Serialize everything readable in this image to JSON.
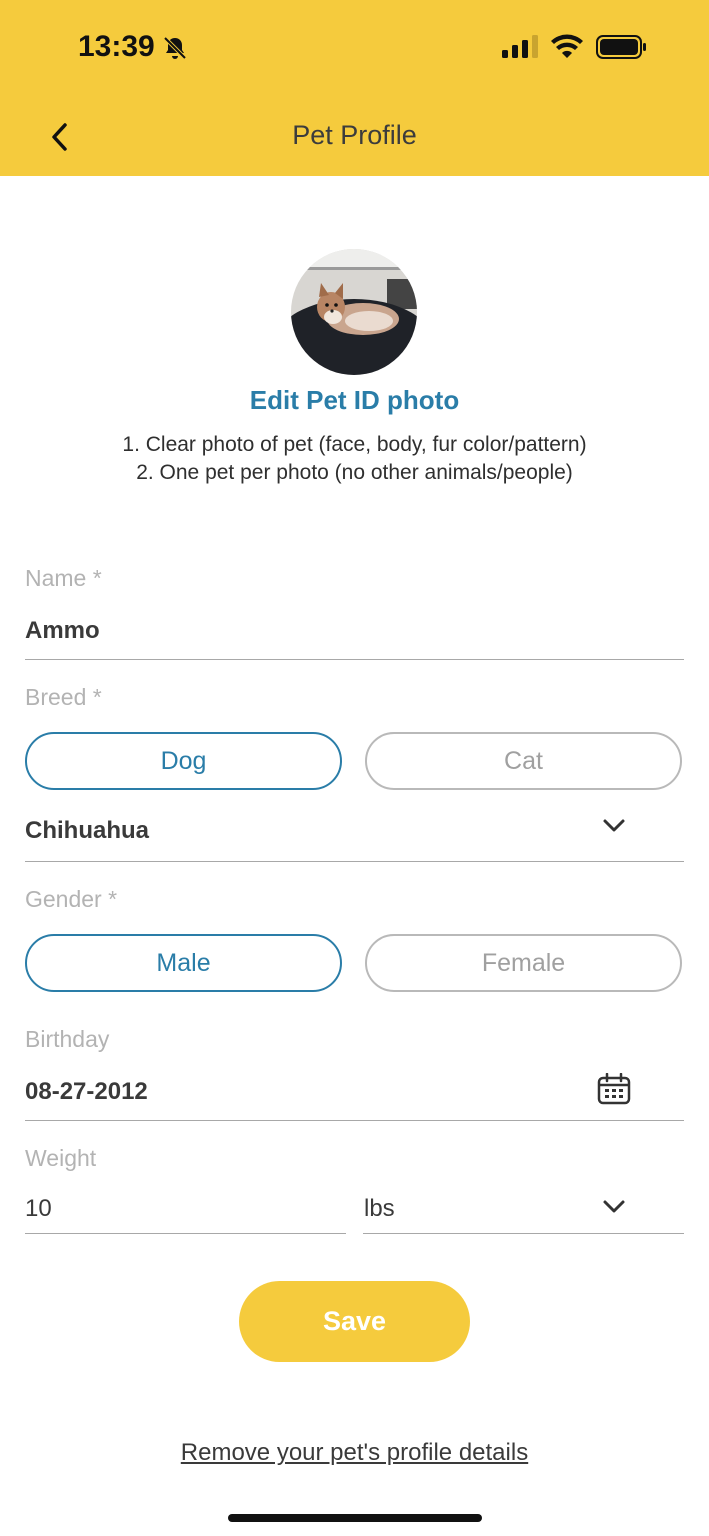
{
  "status_bar": {
    "time": "13:39"
  },
  "header": {
    "title": "Pet Profile"
  },
  "photo": {
    "edit_label": "Edit Pet ID photo"
  },
  "hints": [
    "1. Clear photo of pet (face, body, fur color/pattern)",
    "2. One pet per photo (no other animals/people)"
  ],
  "form": {
    "name": {
      "label": "Name *",
      "value": "Ammo"
    },
    "breed": {
      "label": "Breed *",
      "options": [
        "Dog",
        "Cat"
      ],
      "selected": "Dog",
      "value": "Chihuahua"
    },
    "gender": {
      "label": "Gender *",
      "options": [
        "Male",
        "Female"
      ],
      "selected": "Male"
    },
    "birthday": {
      "label": "Birthday",
      "value": "08-27-2012"
    },
    "weight": {
      "label": "Weight",
      "value": "10",
      "unit": "lbs"
    }
  },
  "actions": {
    "save_label": "Save",
    "remove_label": "Remove your pet's profile details"
  },
  "colors": {
    "header_bg": "#F5CB3D",
    "accent_blue": "#2A7DA8",
    "save_bg": "#F5CB3D"
  }
}
